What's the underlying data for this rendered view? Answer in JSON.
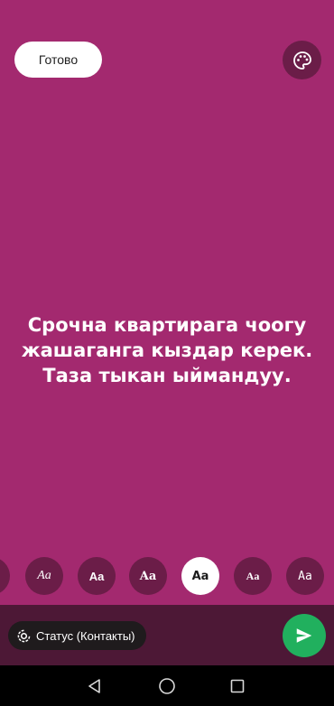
{
  "header": {
    "done_label": "Готово",
    "palette_icon": "palette-icon"
  },
  "status": {
    "lines": [
      "Срочна квартирага чоогу",
      "жашаганга кыздар керек.",
      "Таза тыкан ыймандуу."
    ],
    "background_color": "#a3296f",
    "text_color": "#ffffff"
  },
  "font_picker": {
    "options": [
      {
        "label": "Aa",
        "style": "partial"
      },
      {
        "label": "Aa",
        "style": "italic-serif"
      },
      {
        "label": "Aa",
        "style": "sans-bold"
      },
      {
        "label": "Aa",
        "style": "serif-bold"
      },
      {
        "label": "Aa",
        "style": "sans-heavy",
        "selected": true
      },
      {
        "label": "Aa",
        "style": "slab"
      },
      {
        "label": "Aa",
        "style": "mono"
      }
    ]
  },
  "footer": {
    "audience_label": "Статус (Контакты)",
    "audience_icon": "status-ring-icon",
    "send_icon": "send-icon",
    "send_color": "#21b05e"
  },
  "navigation": {
    "back_icon": "back-triangle-icon",
    "home_icon": "home-circle-icon",
    "recents_icon": "recents-square-icon"
  }
}
